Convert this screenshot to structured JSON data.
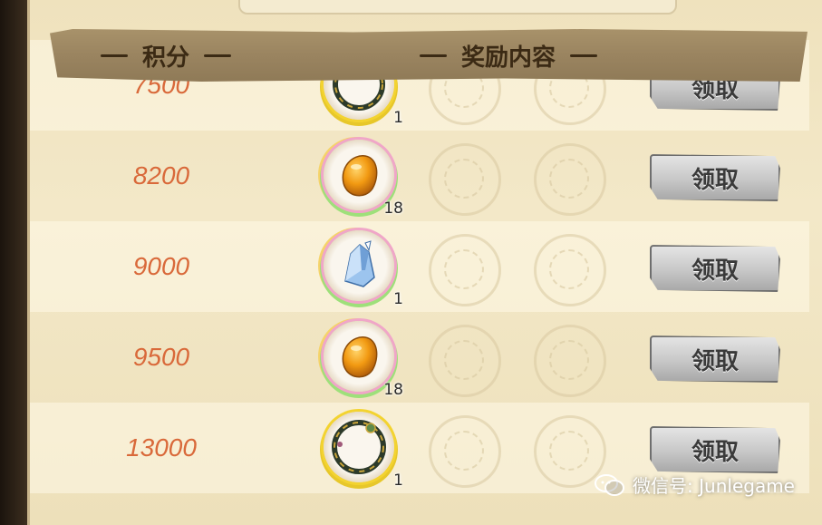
{
  "header": {
    "score_label": "积分",
    "reward_label": "奖励内容"
  },
  "rows": [
    {
      "score": "7500",
      "item_icon": "ring-icon",
      "count": "1",
      "claim_label": "领取"
    },
    {
      "score": "8200",
      "item_icon": "amber-stone-icon",
      "count": "18",
      "claim_label": "领取"
    },
    {
      "score": "9000",
      "item_icon": "crystal-icon",
      "count": "1",
      "claim_label": "领取"
    },
    {
      "score": "9500",
      "item_icon": "amber-stone-icon",
      "count": "18",
      "claim_label": "领取"
    },
    {
      "score": "13000",
      "item_icon": "ring-icon",
      "count": "1",
      "claim_label": "领取"
    }
  ],
  "watermark": {
    "text": "微信号: Junlegame"
  },
  "colors": {
    "score_text": "#d9693a",
    "header_bg": "#9a8460",
    "parchment": "#f3e8c8",
    "claim_button": "#c7c7c7"
  }
}
